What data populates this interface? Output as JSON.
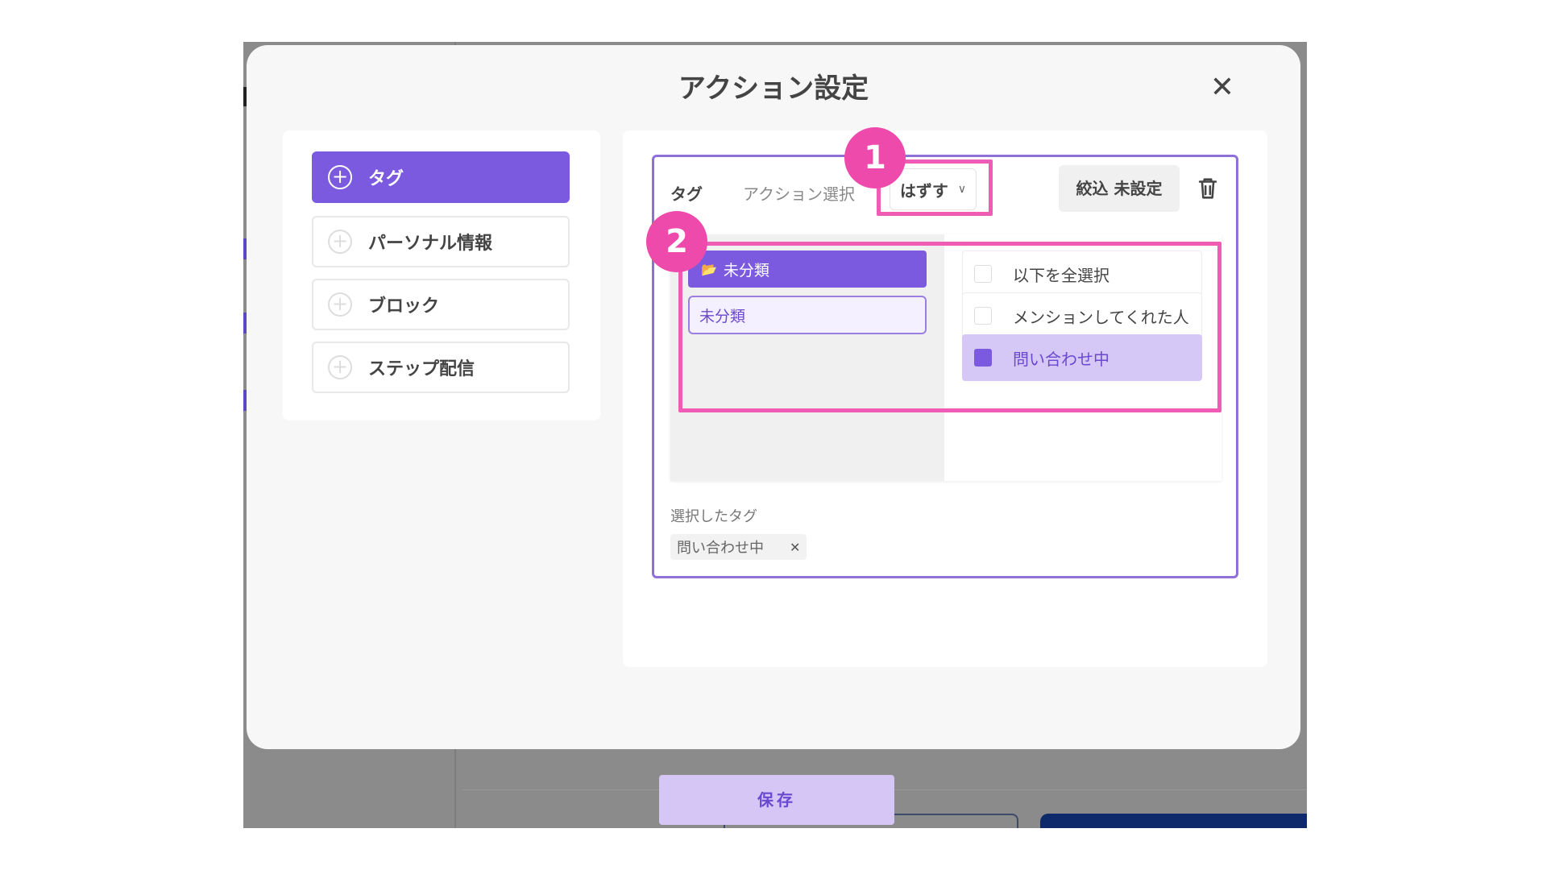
{
  "modal": {
    "title": "アクション設定",
    "close_glyph": "✕"
  },
  "categories": [
    {
      "label": "タグ",
      "active": true
    },
    {
      "label": "パーソナル情報",
      "active": false
    },
    {
      "label": "ブロック",
      "active": false
    },
    {
      "label": "ステップ配信",
      "active": false
    }
  ],
  "action": {
    "type_label": "タグ",
    "action_select_label": "アクション選択",
    "mode_value": "はずす",
    "filter_label": "絞込 未設定"
  },
  "picker": {
    "folder_label": "未分類",
    "subfolder_label": "未分類",
    "options": [
      {
        "label": "以下を全選択",
        "checked": false
      },
      {
        "label": "メンションしてくれた人",
        "checked": false
      },
      {
        "label": "問い合わせ中",
        "checked": true
      }
    ]
  },
  "selected": {
    "heading": "選択したタグ",
    "tags": [
      "問い合わせ中"
    ]
  },
  "footer": {
    "save_label": "保存"
  },
  "annotations": {
    "badge1": "1",
    "badge2": "2",
    "color": "#f05bb5"
  },
  "colors": {
    "accent": "#7b5ae0",
    "accent_light": "#d6c8f6",
    "annotation": "#ee4aac"
  }
}
